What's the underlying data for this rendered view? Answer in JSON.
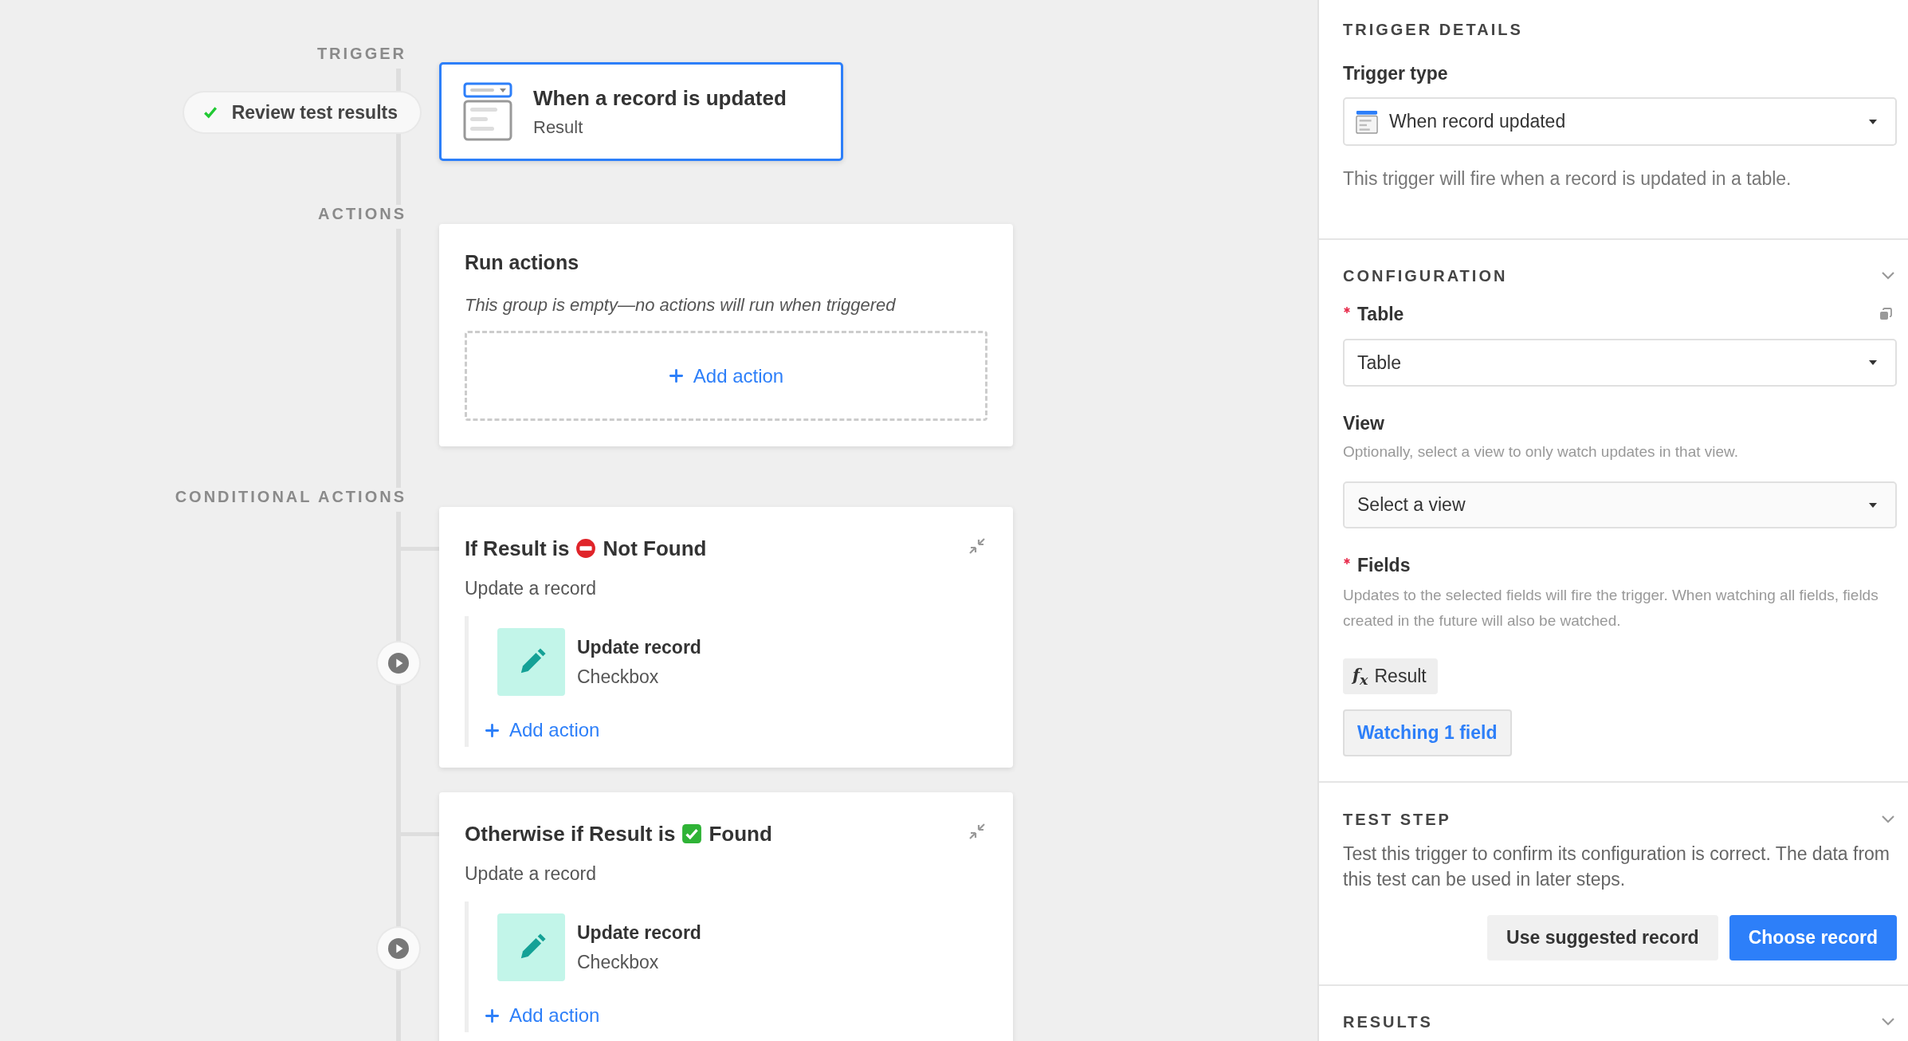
{
  "flow": {
    "trigger": {
      "section_label": "TRIGGER",
      "test_pill": {
        "label": "Review test results",
        "passed": true
      },
      "card": {
        "title": "When a record is updated",
        "subtitle": "Result",
        "selected": true
      }
    },
    "actions": {
      "section_label": "ACTIONS",
      "group": {
        "title": "Run actions",
        "empty_note": "This group is empty—no actions will run when triggered",
        "add_action": "Add action"
      }
    },
    "conditional_actions": {
      "section_label": "CONDITIONAL ACTIONS",
      "groups": [
        {
          "condition": "If Result is",
          "kind": "no-entry",
          "value": "Not Found",
          "subtitle": "Update a record",
          "actions": [
            {
              "title": "Update record",
              "subtitle": "Checkbox"
            }
          ],
          "add_action": "Add action"
        },
        {
          "condition": "Otherwise if Result is",
          "kind": "check",
          "value": "Found",
          "subtitle": "Update a record",
          "actions": [
            {
              "title": "Update record",
              "subtitle": "Checkbox"
            }
          ],
          "add_action": "Add action"
        }
      ]
    }
  },
  "panel": {
    "trigger_details": {
      "heading": "TRIGGER DETAILS",
      "trigger_type": {
        "label": "Trigger type",
        "value": "When record updated"
      },
      "description": "This trigger will fire when a record is updated in a table."
    },
    "configuration": {
      "heading": "CONFIGURATION",
      "table": {
        "label": "Table",
        "required": true,
        "value": "Table"
      },
      "view": {
        "label": "View",
        "required": false,
        "hint": "Optionally, select a view to only watch updates in that view.",
        "placeholder": "Select a view"
      },
      "fields": {
        "label": "Fields",
        "required": true,
        "hint": "Updates to the selected fields will fire the trigger. When watching all fields, fields created in the future will also be watched.",
        "chips": [
          {
            "type_symbol": "f$_{x}$",
            "label": "Result"
          }
        ],
        "watch_button": "Watching 1 field"
      }
    },
    "test_step": {
      "heading": "TEST STEP",
      "description": "Test this trigger to confirm its configuration is correct. The data from this test can be used in later steps.",
      "buttons": [
        {
          "label": "Use suggested record",
          "primary": false
        },
        {
          "label": "Choose record",
          "primary": true
        }
      ]
    },
    "results": {
      "heading": "RESULTS"
    }
  }
}
